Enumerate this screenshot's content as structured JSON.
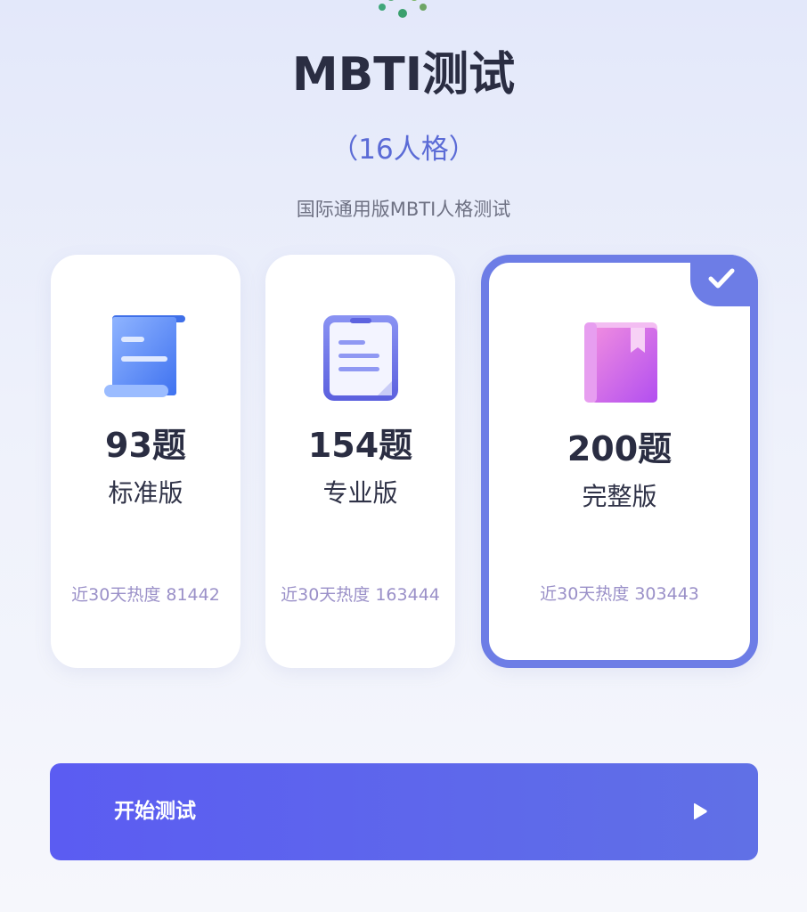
{
  "header": {
    "title": "MBTI测试",
    "subtitle": "（16人格）",
    "description": "国际通用版MBTI人格测试"
  },
  "options": [
    {
      "icon": "scroll-icon",
      "count": "93题",
      "edition": "标准版",
      "heat": "近30天热度 81442",
      "selected": false
    },
    {
      "icon": "clipboard-icon",
      "count": "154题",
      "edition": "专业版",
      "heat": "近30天热度 163444",
      "selected": false
    },
    {
      "icon": "book-icon",
      "count": "200题",
      "edition": "完整版",
      "heat": "近30天热度 303443",
      "selected": true
    }
  ],
  "start_button": {
    "label": "开始测试",
    "icon": "play-icon"
  },
  "colors": {
    "accent": "#6d7de6",
    "button_start": "#5b5cf2",
    "button_end": "#6070e6",
    "title": "#2a2d42",
    "subtitle": "#5b6bd6",
    "heat_text": "#9a90c8"
  }
}
